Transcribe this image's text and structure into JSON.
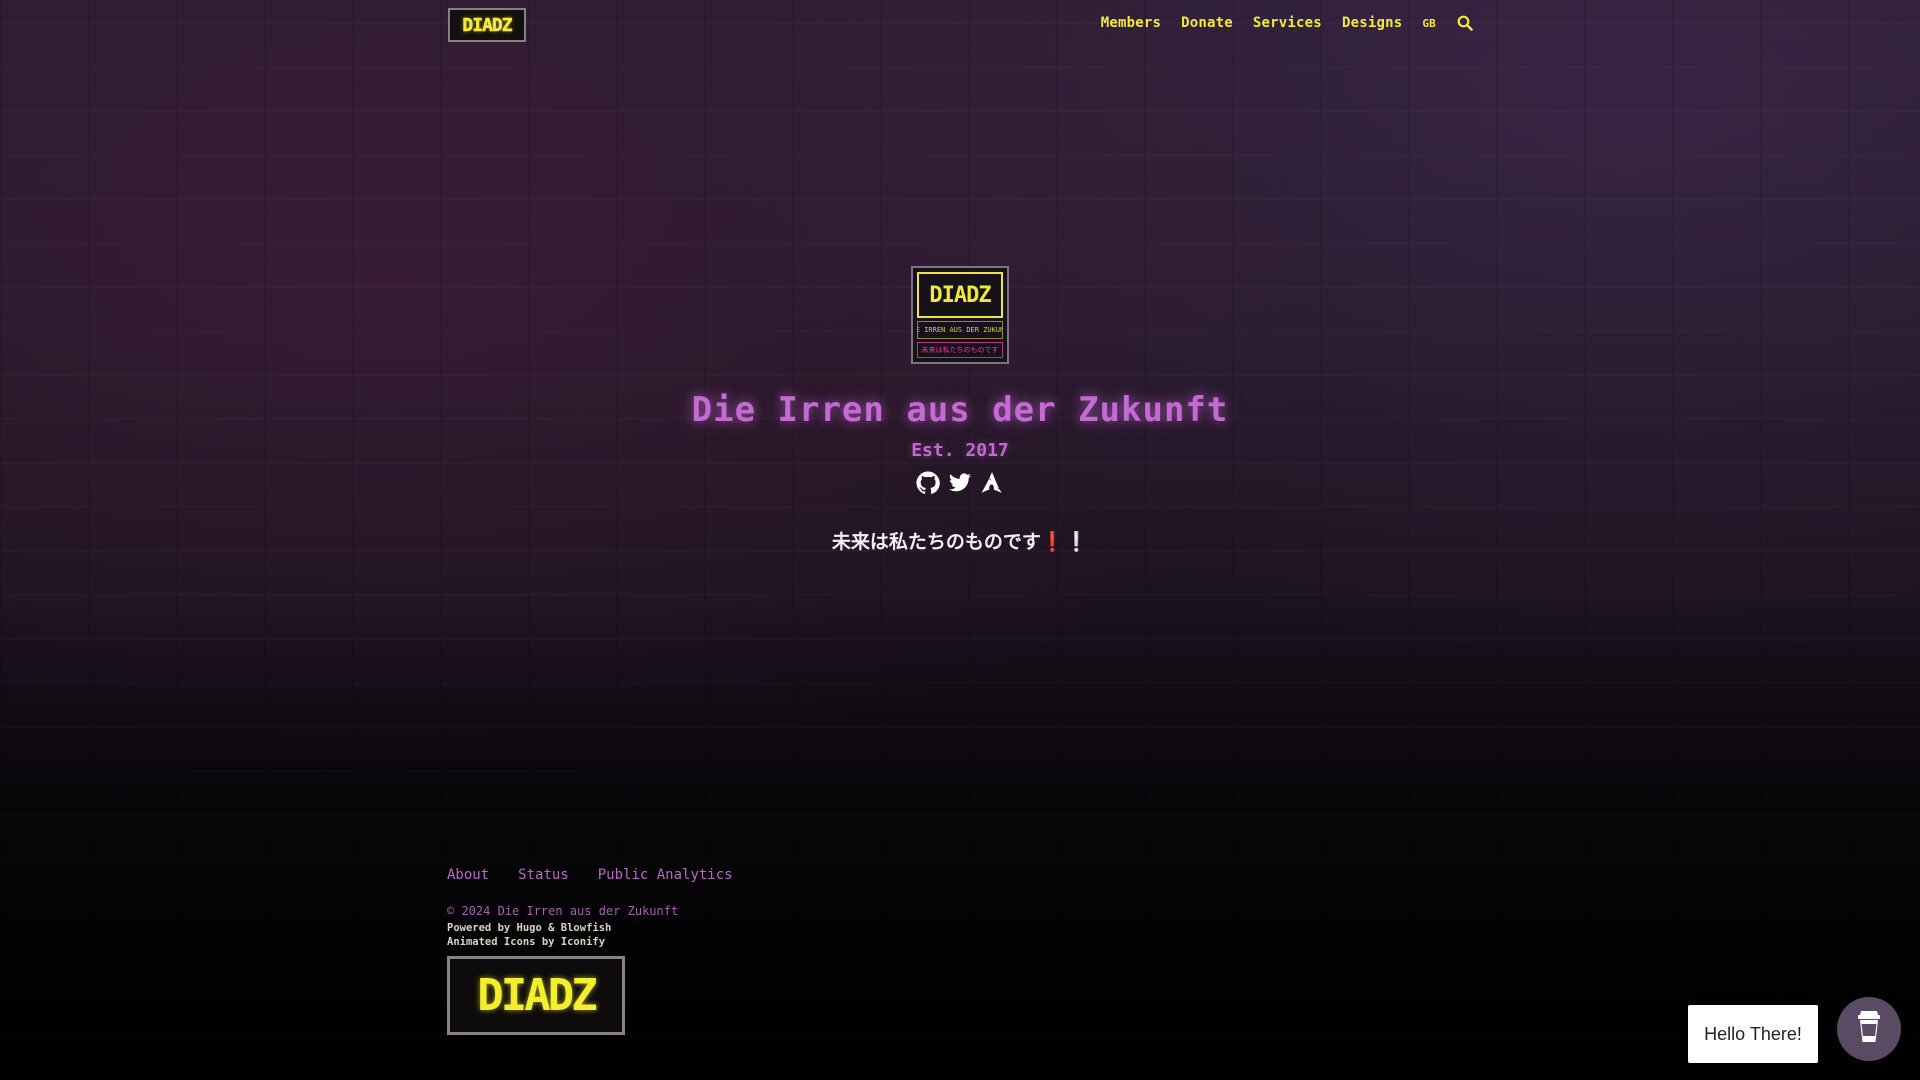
{
  "header": {
    "logo_text": "DIADZ",
    "nav": [
      {
        "label": "Members"
      },
      {
        "label": "Donate"
      },
      {
        "label": "Services"
      },
      {
        "label": "Designs"
      }
    ],
    "lang": "GB",
    "search_icon": "search-icon"
  },
  "hero": {
    "avatar": {
      "top_text": "DIADZ",
      "mid_text": "DIE IRREN AUS DER ZUKUNFT",
      "bottom_text": "未来は私たちのものです"
    },
    "title": "Die Irren aus der Zukunft",
    "subtitle": "Est. 2017",
    "socials": [
      {
        "icon": "github-icon"
      },
      {
        "icon": "twitter-icon"
      },
      {
        "icon": "arch-linux-icon"
      }
    ],
    "tagline": "未来は私たちのものです❗❕"
  },
  "footer": {
    "links": [
      {
        "label": "About"
      },
      {
        "label": "Status"
      },
      {
        "label": "Public Analytics"
      }
    ],
    "copyright": "© 2024 Die Irren aus der Zukunft",
    "powered": "Powered by Hugo & Blowfish",
    "icons_credit": "Animated Icons by Iconify",
    "logo_text": "DIADZ"
  },
  "chat": {
    "bubble_text": "Hello There!",
    "button_icon": "coffee-cup-icon"
  },
  "colors": {
    "accent_yellow": "#f2ea3c",
    "accent_purple": "#c56ad4",
    "background_top": "#2a1b2f",
    "background_bottom": "#050405"
  }
}
